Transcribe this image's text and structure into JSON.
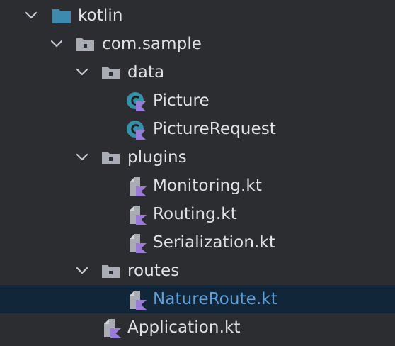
{
  "project_tree": {
    "colors": {
      "background": "#2b2d30",
      "selected_row": "#12263a",
      "text": "#dfe1e5",
      "selected_text": "#5f9fd6",
      "source_folder": "#3d8ab0",
      "package_folder": "#a9adb3",
      "class_icon": "#3591a8",
      "kotlin_icon": "#9b7bd8"
    },
    "items": [
      {
        "label": "kotlin",
        "icon": "source-folder-icon",
        "expanded": true
      },
      {
        "label": "com.sample",
        "icon": "package-icon",
        "expanded": true
      },
      {
        "label": "data",
        "icon": "package-icon",
        "expanded": true
      },
      {
        "label": "Picture",
        "icon": "kotlin-class-icon"
      },
      {
        "label": "PictureRequest",
        "icon": "kotlin-class-icon"
      },
      {
        "label": "plugins",
        "icon": "package-icon",
        "expanded": true
      },
      {
        "label": "Monitoring.kt",
        "icon": "kotlin-file-icon"
      },
      {
        "label": "Routing.kt",
        "icon": "kotlin-file-icon"
      },
      {
        "label": "Serialization.kt",
        "icon": "kotlin-file-icon"
      },
      {
        "label": "routes",
        "icon": "package-icon",
        "expanded": true
      },
      {
        "label": "NatureRoute.kt",
        "icon": "kotlin-file-icon",
        "selected": true
      },
      {
        "label": "Application.kt",
        "icon": "kotlin-file-icon"
      }
    ]
  }
}
